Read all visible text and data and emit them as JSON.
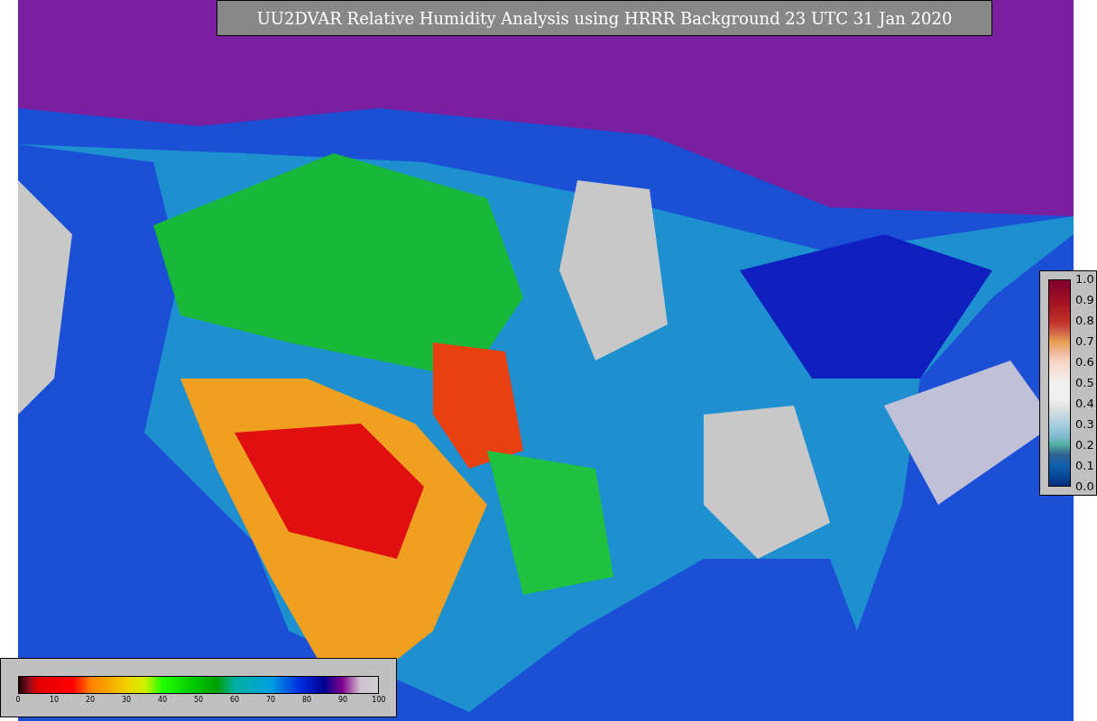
{
  "title": "UU2DVAR Relative Humidity Analysis using HRRR Background 23 UTC 31 Jan 2020",
  "colorbar_bottom": {
    "ticks": [
      "0",
      "10",
      "20",
      "30",
      "40",
      "50",
      "60",
      "70",
      "80",
      "90",
      "100"
    ]
  },
  "colorbar_right": {
    "ticks": [
      "1.0",
      "0.9",
      "0.8",
      "0.7",
      "0.6",
      "0.5",
      "0.4",
      "0.3",
      "0.2",
      "0.1",
      "0.0"
    ]
  }
}
